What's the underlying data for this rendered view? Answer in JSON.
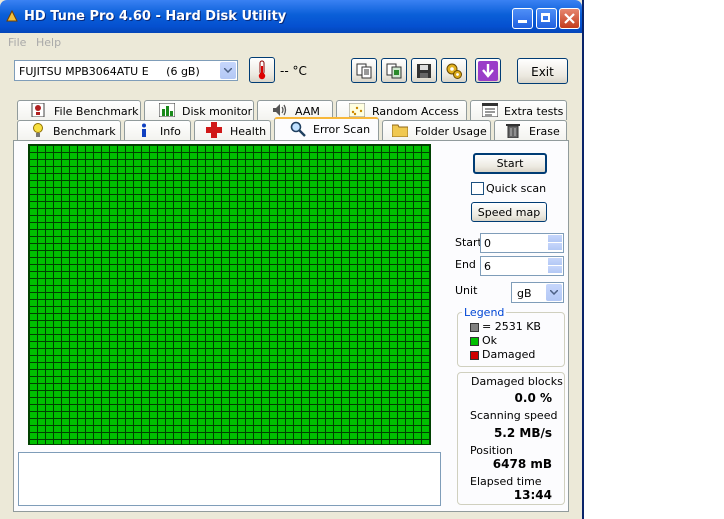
{
  "window": {
    "title": "HD Tune Pro 4.60 - Hard Disk Utility"
  },
  "menu": {
    "file": "File",
    "help": "Help"
  },
  "toolbar": {
    "drive": "FUJITSU MPB3064ATU E     (6 gB)",
    "temperature": "-- °C",
    "exit_label": "Exit"
  },
  "tabs_top": [
    "File Benchmark",
    "Disk monitor",
    "AAM",
    "Random Access",
    "Extra tests"
  ],
  "tabs_bottom": [
    "Benchmark",
    "Info",
    "Health",
    "Error Scan",
    "Folder Usage",
    "Erase"
  ],
  "active_tab": "Error Scan",
  "scan": {
    "start_button": "Start",
    "quick_scan_label": "Quick scan",
    "quick_scan_checked": false,
    "speed_map_button": "Speed map",
    "start_label": "Start",
    "start_value": "0",
    "end_label": "End",
    "end_value": "6",
    "unit_label": "Unit",
    "unit_value": "gB"
  },
  "legend": {
    "title": "Legend",
    "block_size": "= 2531 KB",
    "ok": "Ok",
    "damaged": "Damaged"
  },
  "stats": {
    "damaged_blocks_label": "Damaged blocks",
    "damaged_blocks_value": "0.0 %",
    "scanning_speed_label": "Scanning speed",
    "scanning_speed_value": "5.2 MB/s",
    "position_label": "Position",
    "position_value": "6478 mB",
    "elapsed_label": "Elapsed time",
    "elapsed_value": "13:44"
  },
  "colors": {
    "ok": "#00c000",
    "damaged": "#d00000",
    "block": "#808080",
    "accent": "#0a5fd8"
  }
}
